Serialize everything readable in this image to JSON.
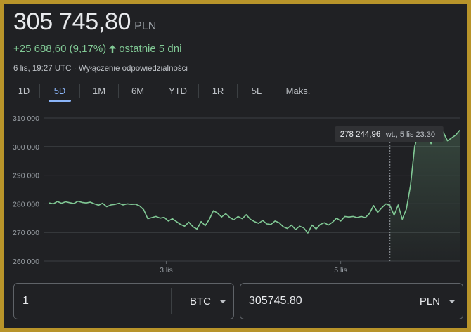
{
  "header": {
    "price": "305 745,80",
    "currency": "PLN",
    "change": "+25 688,60 (9,17%)",
    "period": "ostatnie 5 dni",
    "timestamp": "6 lis, 19:27 UTC",
    "separator": " · ",
    "disclaimer": "Wyłączenie odpowiedzialności"
  },
  "tabs": [
    {
      "label": "1D"
    },
    {
      "label": "5D"
    },
    {
      "label": "1M"
    },
    {
      "label": "6M"
    },
    {
      "label": "YTD"
    },
    {
      "label": "1R"
    },
    {
      "label": "5L"
    },
    {
      "label": "Maks."
    }
  ],
  "active_tab": "5D",
  "tooltip": {
    "value": "278 244,96",
    "date": "wt., 5 lis 23:30"
  },
  "converter": {
    "from_value": "1",
    "from_currency": "BTC",
    "to_value": "305745.80",
    "to_currency": "PLN"
  },
  "colors": {
    "line": "#81c995",
    "positive": "#81c995",
    "accent": "#8ab4f8",
    "background": "#202124"
  },
  "chart_data": {
    "type": "line",
    "ylim": [
      260000,
      310000
    ],
    "yticks": [
      310000,
      300000,
      290000,
      280000,
      270000,
      260000
    ],
    "ytick_labels": [
      "310 000",
      "300 000",
      "290 000",
      "280 000",
      "270 000",
      "260 000"
    ],
    "xtick_labels": [
      {
        "label": "3 lis",
        "x": 0.285
      },
      {
        "label": "5 lis",
        "x": 0.71
      }
    ],
    "hover_x": 0.83,
    "series": [
      {
        "x": [
          0,
          0.01,
          0.02,
          0.03,
          0.04,
          0.05,
          0.06,
          0.07,
          0.08,
          0.09,
          0.1,
          0.11,
          0.12,
          0.13,
          0.14,
          0.15,
          0.16,
          0.17,
          0.18,
          0.19,
          0.2,
          0.21,
          0.22,
          0.23,
          0.24,
          0.25,
          0.26,
          0.27,
          0.28,
          0.29,
          0.3,
          0.31,
          0.32,
          0.33,
          0.34,
          0.35,
          0.36,
          0.37,
          0.38,
          0.39,
          0.4,
          0.41,
          0.42,
          0.43,
          0.44,
          0.45,
          0.46,
          0.47,
          0.48,
          0.49,
          0.5,
          0.51,
          0.52,
          0.53,
          0.54,
          0.55,
          0.56,
          0.57,
          0.58,
          0.59,
          0.6,
          0.61,
          0.62,
          0.63,
          0.64,
          0.65,
          0.66,
          0.67,
          0.68,
          0.69,
          0.7,
          0.71,
          0.72,
          0.73,
          0.74,
          0.75,
          0.76,
          0.77,
          0.78,
          0.79,
          0.8,
          0.81,
          0.82,
          0.83,
          0.84,
          0.85,
          0.86,
          0.87,
          0.88,
          0.89,
          0.9,
          0.91,
          0.92,
          0.93,
          0.94,
          0.95,
          0.96,
          0.97,
          0.98,
          0.99,
          1.0
        ],
        "y": [
          280300,
          280000,
          280800,
          280200,
          280700,
          280400,
          280100,
          280900,
          280500,
          280300,
          280600,
          280000,
          279500,
          280200,
          279000,
          279600,
          279800,
          280200,
          279600,
          280000,
          279800,
          279900,
          279300,
          278000,
          274800,
          275200,
          275600,
          275000,
          275300,
          274000,
          274800,
          273800,
          272800,
          272200,
          273600,
          272000,
          271200,
          273800,
          272400,
          274600,
          277600,
          276800,
          275400,
          276600,
          275200,
          274400,
          275600,
          274800,
          276200,
          274600,
          273800,
          273200,
          274200,
          273000,
          272800,
          274000,
          273400,
          272000,
          271400,
          272600,
          271000,
          272200,
          271600,
          269800,
          272600,
          271200,
          272800,
          273400,
          272600,
          273600,
          275000,
          274000,
          275600,
          275400,
          275600,
          275200,
          275600,
          275200,
          276600,
          279400,
          277000,
          278600,
          280000,
          279400,
          276000,
          279600,
          274600,
          278200,
          286400,
          300000,
          305000,
          303000,
          306000,
          301000,
          307000,
          302000,
          305000,
          302000,
          303000,
          304000,
          305700
        ]
      }
    ]
  }
}
